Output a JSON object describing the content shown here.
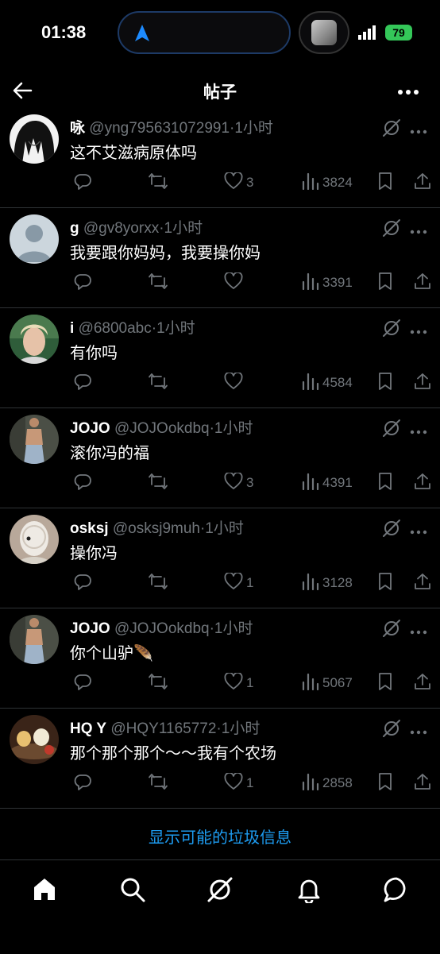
{
  "status": {
    "time": "01:38",
    "battery": "79"
  },
  "header": {
    "title": "帖子"
  },
  "posts": [
    {
      "name": "咏",
      "handle": "@yng795631072991",
      "time": "·1小时",
      "text": "这不艾滋病原体吗",
      "likes": "3",
      "views": "3824",
      "avatar": "anime-dark-hair"
    },
    {
      "name": "g",
      "handle": "@gv8yorxx",
      "time": "·1小时",
      "text": "我要跟你妈妈，我要操你妈",
      "likes": "",
      "views": "3391",
      "avatar": "default"
    },
    {
      "name": "i",
      "handle": "@6800abc",
      "time": "·1小时",
      "text": "有你吗",
      "likes": "",
      "views": "4584",
      "avatar": "blond-person"
    },
    {
      "name": "JOJO",
      "handle": "@JOJOokdbq",
      "time": "·1小时",
      "text": "滚你冯的福",
      "likes": "3",
      "views": "4391",
      "avatar": "shirtless-man"
    },
    {
      "name": "osksj",
      "handle": "@osksj9muh",
      "time": "·1小时",
      "text": "操你冯",
      "likes": "1",
      "views": "3128",
      "avatar": "white-mask"
    },
    {
      "name": "JOJO",
      "handle": "@JOJOokdbq",
      "time": "·1小时",
      "text": "你个山驴🪶",
      "likes": "1",
      "views": "5067",
      "avatar": "shirtless-man"
    },
    {
      "name": "HQ Y",
      "handle": "@HQY1165772",
      "time": "·1小时",
      "text": "那个那个那个～～我有个农场",
      "likes": "1",
      "views": "2858",
      "avatar": "tea-set"
    }
  ],
  "footer": {
    "spam_link": "显示可能的垃圾信息"
  },
  "tabs": [
    "home-icon",
    "search-icon",
    "grok-icon",
    "notifications-icon",
    "messages-icon"
  ]
}
